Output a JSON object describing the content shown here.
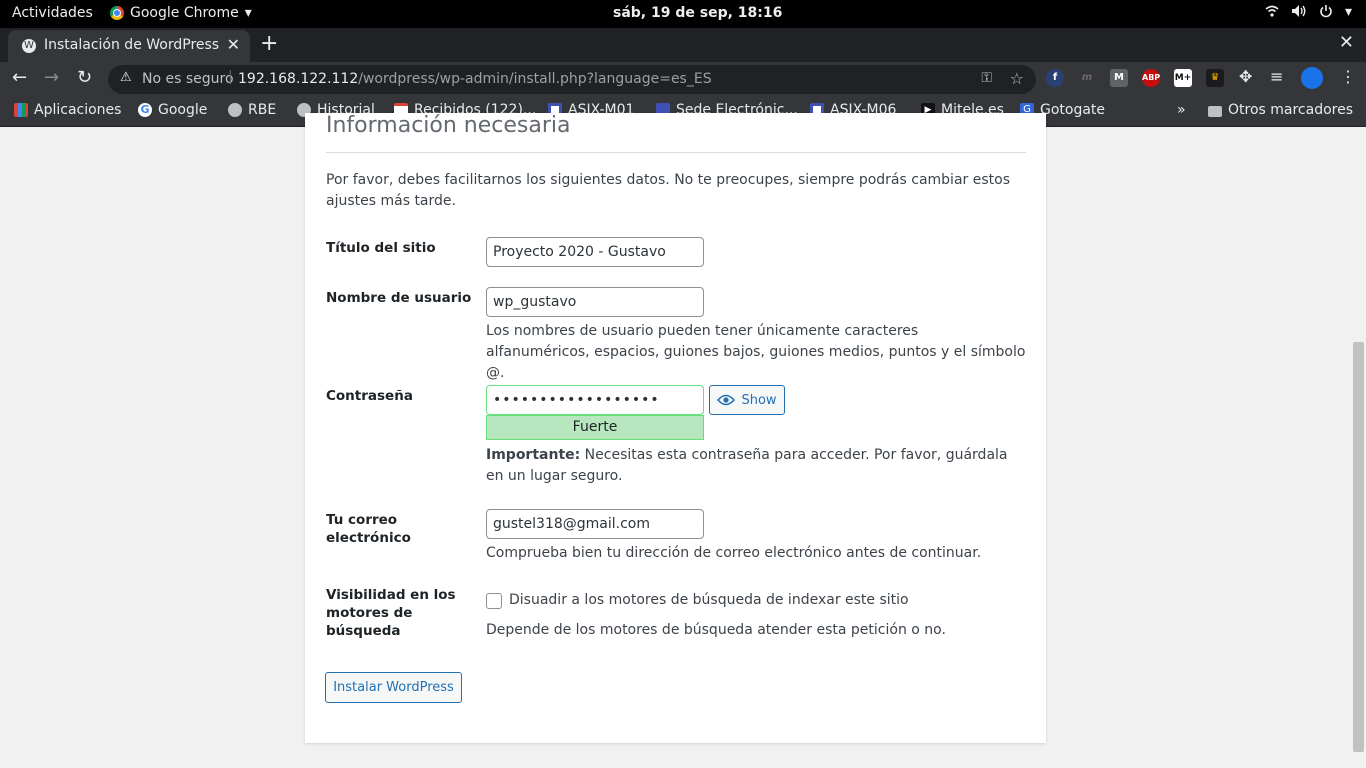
{
  "system_bar": {
    "activities": "Actividades",
    "app_name": "Google Chrome",
    "clock": "sáb, 19 de sep, 18:16"
  },
  "tabs": [
    {
      "title": "Instalación de WordPress",
      "active": true
    }
  ],
  "toolbar": {
    "security_label": "No es seguro",
    "url_host": "192.168.122.112",
    "url_path": "/wordpress/wp-admin/install.php?language=es_ES",
    "extensions": [
      "f",
      "m",
      "M",
      "ABP",
      "M+",
      "♛"
    ]
  },
  "bookmarks": {
    "items": [
      "Aplicaciones",
      "Google",
      "RBE",
      "Historial",
      "Recibidos (122)...",
      "ASIX-M01",
      "Sede Electrónic...",
      "ASIX-M06",
      "Mitele.es",
      "Gotogate"
    ],
    "overflow": "»",
    "other": "Otros marcadores"
  },
  "form": {
    "heading": "Información necesaria",
    "intro": "Por favor, debes facilitarnos los siguientes datos. No te preocupes, siempre podrás cambiar estos ajustes más tarde.",
    "site_title_label": "Título del sitio",
    "site_title_value": "Proyecto 2020 - Gustavo",
    "username_label": "Nombre de usuario",
    "username_value": "wp_gustavo",
    "username_help": "Los nombres de usuario pueden tener únicamente caracteres alfanuméricos, espacios, guiones bajos, guiones medios, puntos y el símbolo @.",
    "password_label": "Contraseña",
    "password_value": "••••••••••••••••••",
    "show_label": "Show",
    "strength": "Fuerte",
    "password_help_strong": "Importante:",
    "password_help": " Necesitas esta contraseña para acceder. Por favor, guárdala en un lugar seguro.",
    "email_label": "Tu correo electrónico",
    "email_value": "gustel318@gmail.com",
    "email_help": "Comprueba bien tu dirección de correo electrónico antes de continuar.",
    "visibility_label": "Visibilidad en los motores de búsqueda",
    "visibility_checkbox_label": "Disuadir a los motores de búsqueda de indexar este sitio",
    "visibility_checked": false,
    "visibility_help": "Depende de los motores de búsqueda atender esta petición o no.",
    "submit_label": "Instalar WordPress"
  },
  "colors": {
    "accent": "#2271b1",
    "strength_bg": "#b8e6bf",
    "strength_border": "#68de7c"
  }
}
